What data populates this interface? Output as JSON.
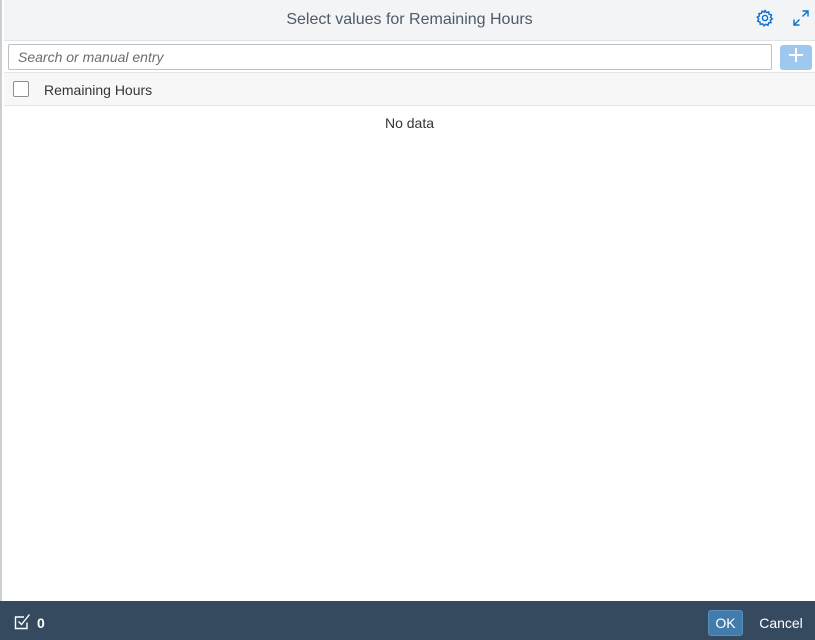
{
  "dialog": {
    "title": "Select values for Remaining Hours"
  },
  "toolbar": {
    "settings_icon": "gear-icon",
    "expand_icon": "expand-icon"
  },
  "search": {
    "placeholder": "Search or manual entry",
    "value": "",
    "add_icon": "plus-icon"
  },
  "table": {
    "column_header": "Remaining Hours",
    "select_all_checked": false,
    "empty_text": "No data"
  },
  "footer": {
    "selected_count": "0",
    "ok_label": "OK",
    "cancel_label": "Cancel"
  },
  "colors": {
    "footer_bg": "#354a5f",
    "ok_bg": "#427cac",
    "add_bg": "#9ec8ee",
    "header_bg": "#f2f4f6"
  }
}
